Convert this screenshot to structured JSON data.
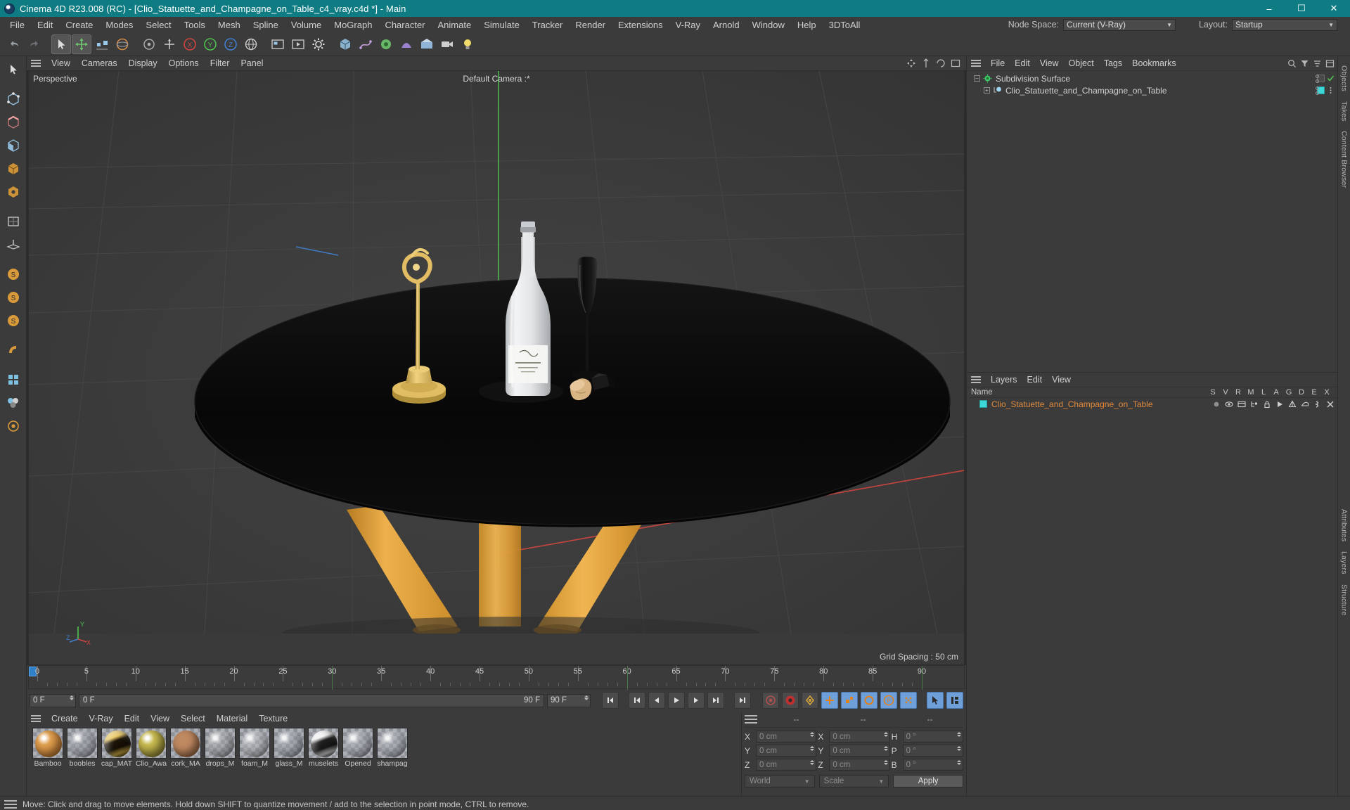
{
  "titlebar": {
    "app_icon": "c4d-logo-icon",
    "title": "Cinema 4D R23.008 (RC) - [Clio_Statuette_and_Champagne_on_Table_c4_vray.c4d *] - Main",
    "minimize": "–",
    "maximize": "☐",
    "close": "✕"
  },
  "menubar": {
    "items": [
      "File",
      "Edit",
      "Create",
      "Modes",
      "Select",
      "Tools",
      "Mesh",
      "Spline",
      "Volume",
      "MoGraph",
      "Character",
      "Animate",
      "Simulate",
      "Tracker",
      "Render",
      "Extensions",
      "V-Ray",
      "Arnold",
      "Window",
      "Help",
      "3DToAll"
    ],
    "node_space_label": "Node Space:",
    "node_space_value": "Current (V-Ray)",
    "layout_label": "Layout:",
    "layout_value": "Startup"
  },
  "toolbar": {
    "buttons": [
      {
        "name": "undo-button",
        "icon": "undo-arrow-icon"
      },
      {
        "name": "redo-button",
        "icon": "redo-arrow-icon"
      },
      {
        "name": "select-tool-button",
        "icon": "cursor-arrow-icon"
      },
      {
        "name": "move-tool-button",
        "icon": "move-cross-icon"
      },
      {
        "name": "scale-tool-button",
        "icon": "scale-icon"
      },
      {
        "name": "rotate-tool-button",
        "icon": "rotate-icon"
      },
      {
        "name": "paint-tool-button",
        "icon": "paint-icon"
      },
      {
        "name": "world-axis-button",
        "icon": "axis-icon"
      },
      {
        "name": "lock-x-axis-button",
        "icon": "x-axis-icon"
      },
      {
        "name": "lock-y-axis-button",
        "icon": "y-axis-icon"
      },
      {
        "name": "lock-z-axis-button",
        "icon": "z-axis-icon"
      },
      {
        "name": "world-object-coordinate-button",
        "icon": "world-coord-icon"
      },
      {
        "name": "render-view-button",
        "icon": "render-frame-icon"
      },
      {
        "name": "render-region-button",
        "icon": "render-play-icon"
      },
      {
        "name": "render-settings-button",
        "icon": "render-gear-icon"
      },
      {
        "name": "primitive-cube-button",
        "icon": "cube-icon"
      },
      {
        "name": "spline-pen-button",
        "icon": "spline-pen-icon"
      },
      {
        "name": "generator-button",
        "icon": "generator-icon"
      },
      {
        "name": "deformer-button",
        "icon": "deformer-icon"
      },
      {
        "name": "environment-button",
        "icon": "environment-icon"
      },
      {
        "name": "camera-button",
        "icon": "camera-icon"
      },
      {
        "name": "light-button",
        "icon": "light-bulb-icon"
      }
    ]
  },
  "left_toolbar": {
    "buttons": [
      {
        "name": "live-selection-button",
        "icon": "arrow-cursor-icon"
      },
      {
        "name": "point-mode-button",
        "icon": "point-mode-icon"
      },
      {
        "name": "edge-mode-button",
        "icon": "edge-mode-icon"
      },
      {
        "name": "polygon-mode-button",
        "icon": "polygon-mode-icon"
      },
      {
        "name": "model-mode-button",
        "icon": "model-mode-icon"
      },
      {
        "name": "object-mode-button",
        "icon": "object-mode-icon"
      },
      {
        "name": "texture-mode-button",
        "icon": "texture-axis-icon"
      },
      {
        "name": "workplane-button",
        "icon": "workplane-icon"
      },
      {
        "name": "enable-axis-button",
        "icon": "axis-lock-icon"
      },
      {
        "name": "enable-snap-button",
        "icon": "snap-icon"
      },
      {
        "name": "viewport-solo-button",
        "icon": "solo-icon"
      },
      {
        "name": "uv-mode-button",
        "icon": "uv-icon"
      },
      {
        "name": "deformer-toggle-button",
        "icon": "deform-toggle-icon"
      },
      {
        "name": "quantize-button",
        "icon": "quantize-icon"
      },
      {
        "name": "layer-color-button",
        "icon": "layer-color-icon"
      }
    ]
  },
  "viewport": {
    "panel_menu": [
      "View",
      "Cameras",
      "Display",
      "Options",
      "Filter",
      "Panel"
    ],
    "label_top_left": "Perspective",
    "label_top_center": "Default Camera :*",
    "grid_spacing": "Grid Spacing : 50 cm",
    "axis_x": "X",
    "axis_y": "Y",
    "axis_z": "Z",
    "colors": {
      "background": "#3a3a3a",
      "grid_line": "#4a4a4a",
      "axis_x": "#d1453e",
      "axis_y": "#4dc24d",
      "axis_z": "#3f7fd1",
      "table_top": "#0b0b0b",
      "table_leg": "#e0a13a",
      "bottle": "#e8e8ea",
      "glass": "#151515",
      "statuette": "#e3bf6b",
      "cork": "#d8b483"
    }
  },
  "timeline": {
    "ruler_max": 90,
    "ticks": [
      0,
      5,
      10,
      15,
      20,
      25,
      30,
      35,
      40,
      45,
      50,
      55,
      60,
      65,
      70,
      75,
      80,
      85,
      90
    ],
    "current_frame_field": "0 F",
    "start_field": "0 F",
    "preview_min": "0 F",
    "preview_max": "90 F",
    "end_field": "90 F",
    "transport": [
      {
        "name": "go-to-start-button",
        "icon": "skip-start-icon"
      },
      {
        "name": "previous-keyframe-button",
        "icon": "prev-key-icon"
      },
      {
        "name": "step-back-button",
        "icon": "step-back-icon"
      },
      {
        "name": "play-button",
        "icon": "play-icon"
      },
      {
        "name": "step-forward-button",
        "icon": "step-forward-icon"
      },
      {
        "name": "next-keyframe-button",
        "icon": "next-key-icon"
      },
      {
        "name": "go-to-end-button",
        "icon": "skip-end-icon"
      },
      {
        "name": "record-active-objects-button",
        "icon": "record-circle-icon"
      },
      {
        "name": "autokeying-button",
        "icon": "autokey-icon"
      },
      {
        "name": "keyframe-selection-button",
        "icon": "key-select-icon"
      },
      {
        "name": "position-key-button",
        "icon": "position-key-icon"
      },
      {
        "name": "scale-key-button",
        "icon": "scale-key-icon"
      },
      {
        "name": "rotation-key-button",
        "icon": "rotation-key-icon"
      },
      {
        "name": "parameter-key-button",
        "icon": "param-key-icon"
      },
      {
        "name": "point-level-anim-button",
        "icon": "pla-icon"
      },
      {
        "name": "animation-mode-button",
        "icon": "anim-mode-icon"
      },
      {
        "name": "auto-keying-toggle-button",
        "icon": "auto-key-toggle-icon"
      }
    ]
  },
  "materials": {
    "menu": [
      "Create",
      "V-Ray",
      "Edit",
      "View",
      "Select",
      "Material",
      "Texture"
    ],
    "items": [
      {
        "name": "Bamboo",
        "color1": "#e0a04f",
        "color2": "#b06a28",
        "type": "glossy"
      },
      {
        "name": "boobles",
        "color1": "#9aa0a8",
        "color2": "#8d9097",
        "type": "transparent"
      },
      {
        "name": "cap_MAT",
        "color1": "#e8c14a",
        "color2": "#1a1206",
        "type": "metal"
      },
      {
        "name": "Clio_Awa",
        "color1": "#c9bb52",
        "color2": "#7d7328",
        "type": "glossy"
      },
      {
        "name": "cork_MA",
        "color1": "#c08a62",
        "color2": "#8a5b38",
        "type": "rough"
      },
      {
        "name": "drops_M",
        "color1": "#b3b3b3",
        "color2": "#8e8e8e",
        "type": "transparent"
      },
      {
        "name": "foam_M",
        "color1": "#cfcfcf",
        "color2": "#a6a6a6",
        "type": "transparent"
      },
      {
        "name": "glass_M",
        "color1": "#a9b0b8",
        "color2": "#858d95",
        "type": "transparent"
      },
      {
        "name": "muselets",
        "color1": "#f2f2f2",
        "color2": "#1c1c1c",
        "type": "metal"
      },
      {
        "name": "Opened",
        "color1": "#b7bcc2",
        "color2": "#8a9096",
        "type": "transparent"
      },
      {
        "name": "shampag",
        "color1": "#b7bcc2",
        "color2": "#8f969c",
        "type": "transparent"
      }
    ]
  },
  "coordinates": {
    "header": [
      "--",
      "--",
      "--"
    ],
    "rows": [
      {
        "pos_label": "X",
        "pos_value": "0 cm",
        "size_label": "X",
        "size_value": "0 cm",
        "rot_label": "H",
        "rot_value": "0 °"
      },
      {
        "pos_label": "Y",
        "pos_value": "0 cm",
        "size_label": "Y",
        "size_value": "0 cm",
        "rot_label": "P",
        "rot_value": "0 °"
      },
      {
        "pos_label": "Z",
        "pos_value": "0 cm",
        "size_label": "Z",
        "size_value": "0 cm",
        "rot_label": "B",
        "rot_value": "0 °"
      }
    ],
    "world_select": "World",
    "scale_select": "Scale",
    "apply_button": "Apply"
  },
  "object_manager": {
    "menu": [
      "File",
      "Edit",
      "View",
      "Object",
      "Tags",
      "Bookmarks"
    ],
    "rows": [
      {
        "name": "Subdivision Surface",
        "icon": "subdivision-surface-icon",
        "indent": 0
      },
      {
        "name": "Clio_Statuette_and_Champagne_on_Table",
        "icon": "null-object-icon",
        "indent": 1
      }
    ]
  },
  "layers_manager": {
    "menu": [
      "Layers",
      "Edit",
      "View"
    ],
    "name_header": "Name",
    "columns": [
      "S",
      "V",
      "R",
      "M",
      "L",
      "A",
      "G",
      "D",
      "E",
      "X"
    ],
    "rows": [
      {
        "name": "Clio_Statuette_and_Champagne_on_Table",
        "color": "#3ed7d7"
      }
    ]
  },
  "right_tabs": [
    "Objects",
    "Takes",
    "Content Browser",
    "Attributes",
    "Layers",
    "Structure"
  ],
  "statusbar": {
    "message": "Move: Click and drag to move elements. Hold down SHIFT to quantize movement / add to the selection in point mode, CTRL to remove."
  }
}
